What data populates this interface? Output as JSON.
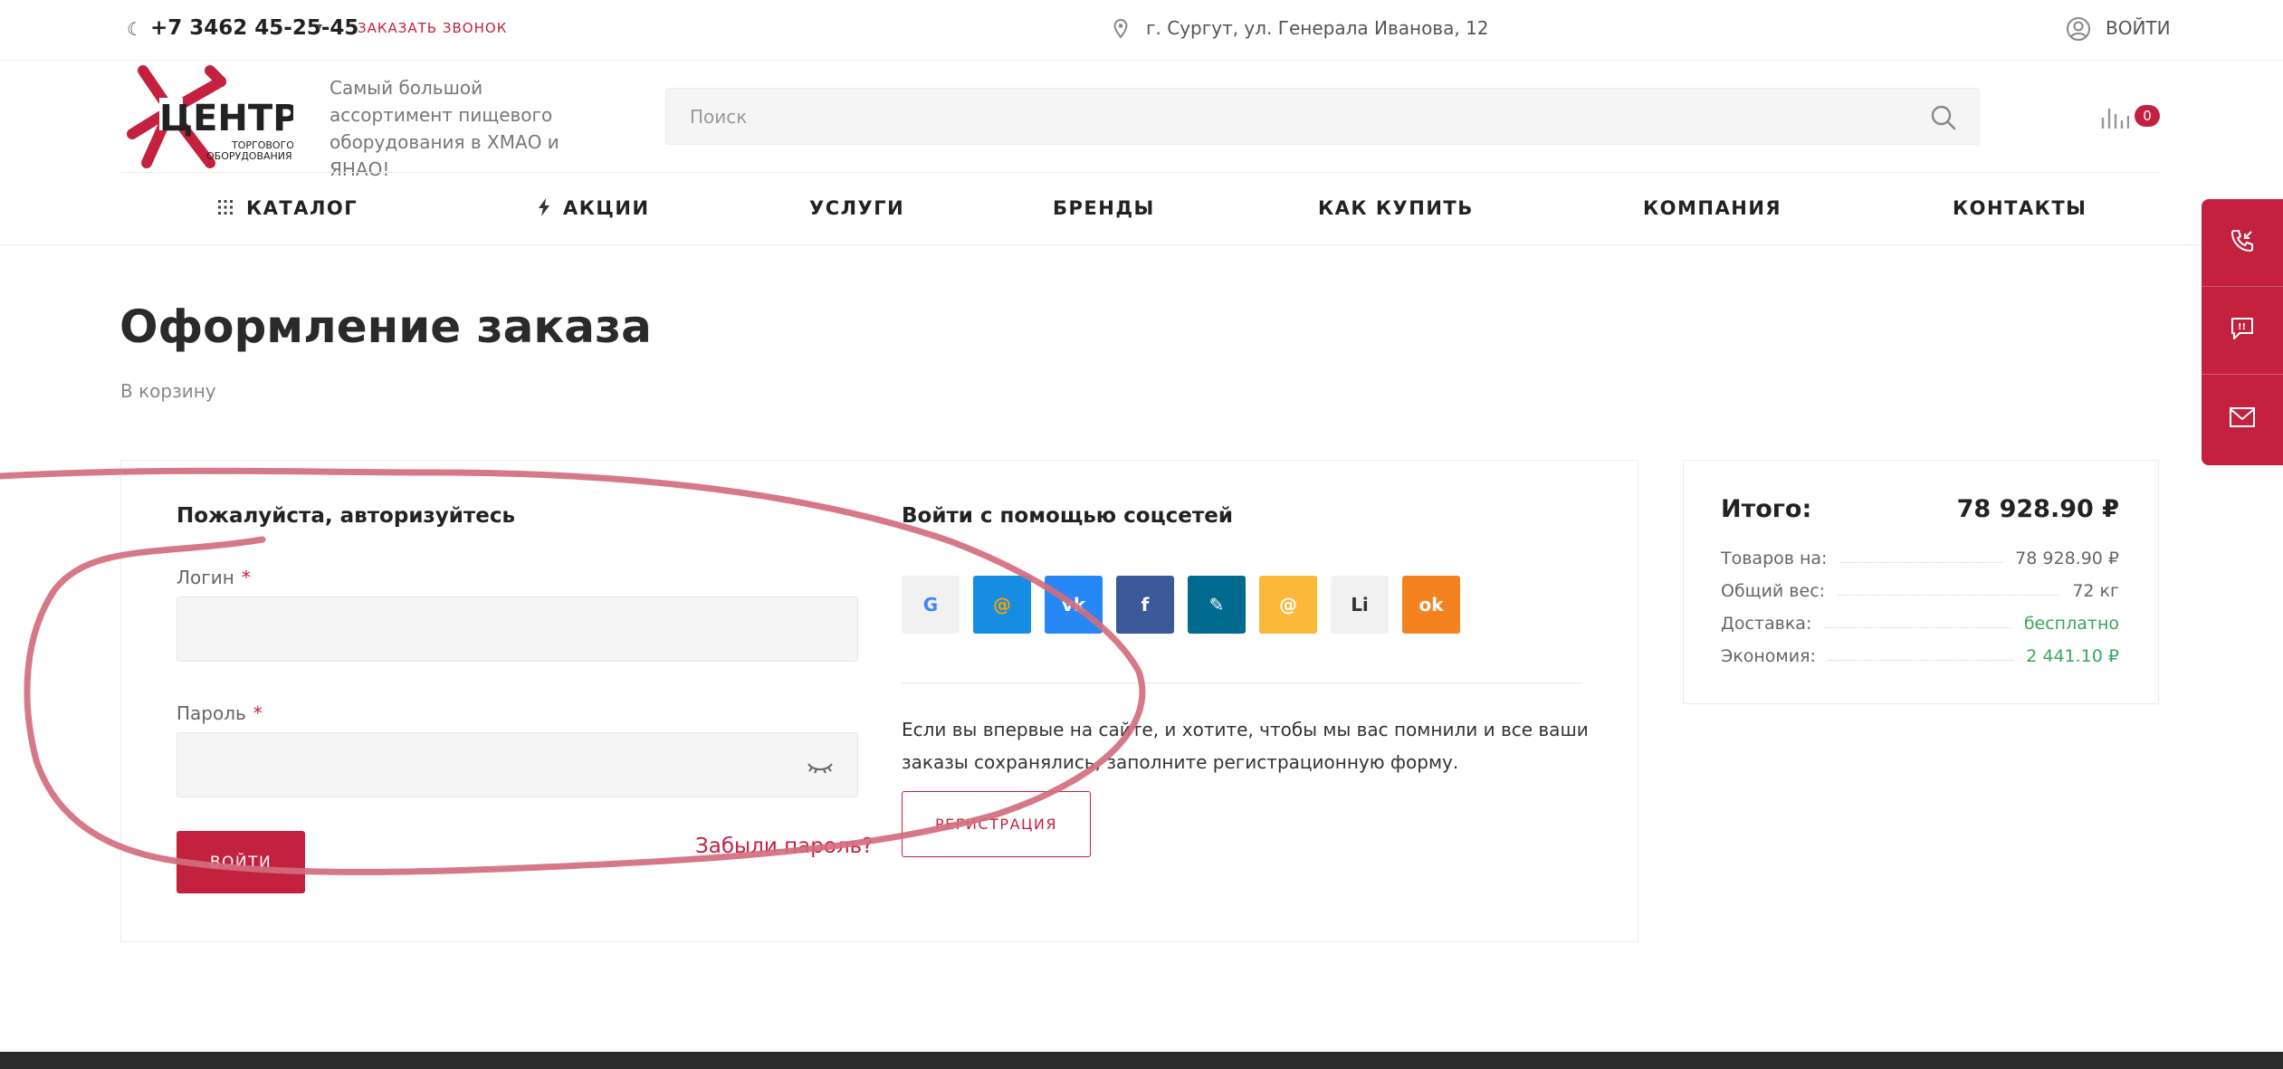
{
  "topbar": {
    "phone": "+7 3462 45-25-45",
    "callback": "ЗАКАЗАТЬ ЗВОНОК",
    "address": "г. Сургут, ул. Генерала Иванова, 12",
    "login": "ВОЙТИ"
  },
  "header": {
    "logo_text": {
      "main": "ЦЕНТР",
      "line1": "ТОРГОВОГО",
      "line2": "ОБОРУДОВАНИЯ"
    },
    "slogan": "Самый большой ассортимент пищевого оборудования в ХМАО и ЯНАО!",
    "search_placeholder": "Поиск",
    "compare_count": "0"
  },
  "nav": {
    "catalog": "КАТАЛОГ",
    "promos": "АКЦИИ",
    "services": "УСЛУГИ",
    "brands": "БРЕНДЫ",
    "how_to_buy": "КАК КУПИТЬ",
    "company": "КОМПАНИЯ",
    "contacts": "КОНТАКТЫ"
  },
  "page": {
    "title": "Оформление заказа",
    "back_link": "В корзину"
  },
  "auth": {
    "title": "Пожалуйста, авторизуйтесь",
    "login_label": "Логин",
    "password_label": "Пароль",
    "required_mark": "*",
    "login_button": "ВОЙТИ",
    "forgot": "Забыли пароль?"
  },
  "social": {
    "title": "Войти с помощью соцсетей",
    "buttons": [
      {
        "icon": "google-icon",
        "glyph": "G",
        "bg": "#f1f1f1",
        "fg": "#4285f4"
      },
      {
        "icon": "mailru-icon",
        "glyph": "@",
        "bg": "#168de2",
        "fg": "#ff9e00"
      },
      {
        "icon": "vk-icon",
        "glyph": "vk",
        "bg": "#2787f5",
        "fg": "#ffffff"
      },
      {
        "icon": "facebook-icon",
        "glyph": "f",
        "bg": "#3b5998",
        "fg": "#ffffff"
      },
      {
        "icon": "livejournal-icon",
        "glyph": "✎",
        "bg": "#006b8f",
        "fg": "#ffffff"
      },
      {
        "icon": "mail-icon",
        "glyph": "@",
        "bg": "#fbb939",
        "fg": "#ffffff"
      },
      {
        "icon": "liveinternet-icon",
        "glyph": "Li",
        "bg": "#f1f1f1",
        "fg": "#333333"
      },
      {
        "icon": "odnoklassniki-icon",
        "glyph": "ok",
        "bg": "#f58220",
        "fg": "#ffffff"
      }
    ],
    "reg_text": "Если вы впервые на сайте, и хотите, чтобы мы вас помнили и все ваши заказы сохранялись, заполните регистрационную форму.",
    "reg_button": "РЕГИСТРАЦИЯ"
  },
  "totals": {
    "title": "Итого:",
    "sum": "78 928.90 ₽",
    "rows": [
      {
        "label": "Товаров на:",
        "value": "78 928.90 ₽"
      },
      {
        "label": "Общий вес:",
        "value": "72 кг"
      },
      {
        "label": "Доставка:",
        "value": "бесплатно"
      },
      {
        "label": "Экономия:",
        "value": "2 441.10 ₽"
      }
    ]
  },
  "colors": {
    "accent": "#c4213f",
    "green": "#3aa55d",
    "annotation": "#d26c7d"
  }
}
